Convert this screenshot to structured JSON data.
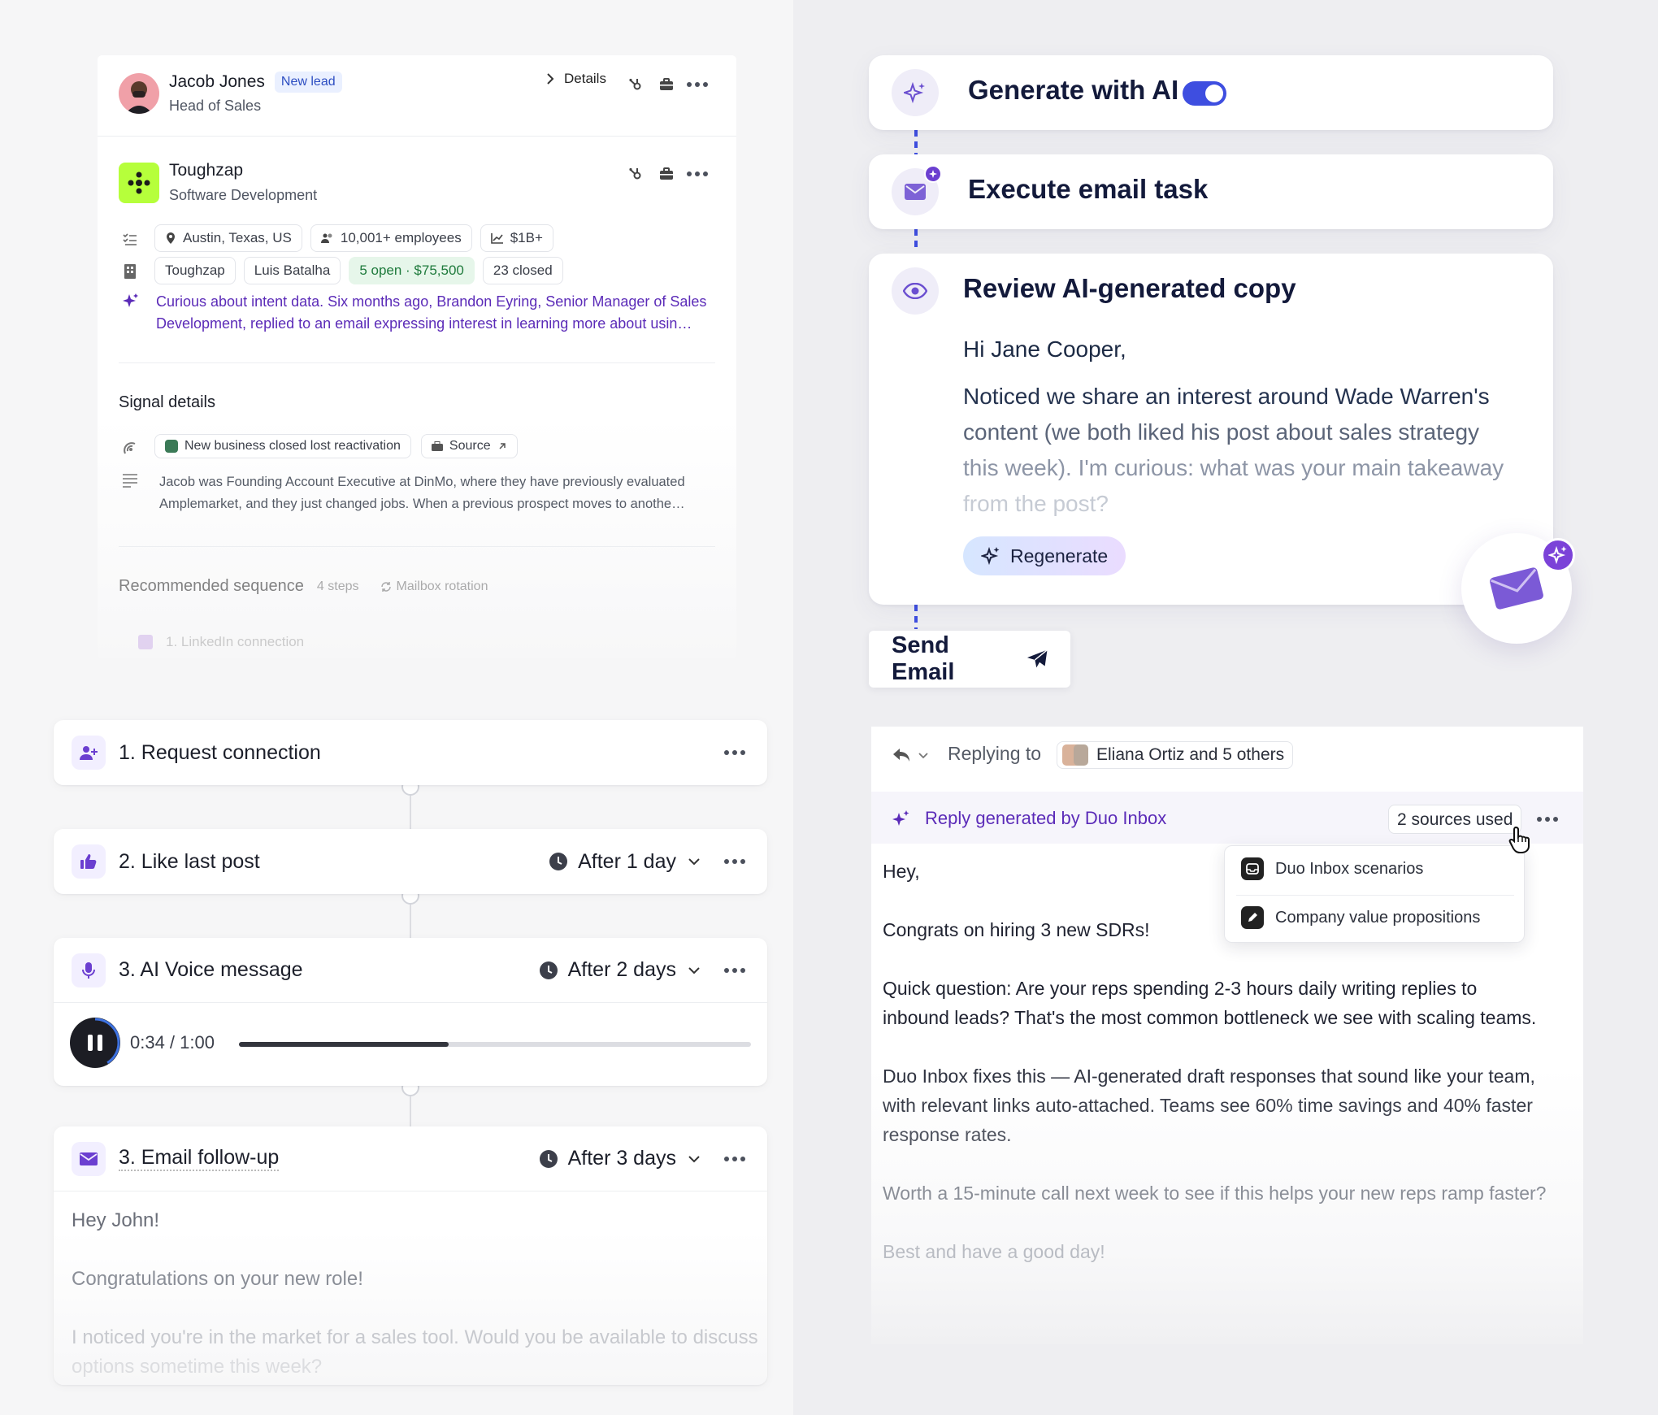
{
  "lead": {
    "name": "Jacob Jones",
    "badge": "New lead",
    "title": "Head of Sales",
    "details_label": "Details"
  },
  "company": {
    "name": "Toughzap",
    "industry": "Software Development",
    "location": "Austin, Texas, US",
    "employees": "10,001+ employees",
    "revenue": "$1B+",
    "account_name": "Toughzap",
    "owner": "Luis Batalha",
    "open_deals": "5 open · $75,500",
    "closed_deals": "23 closed",
    "insight": "Curious about intent data. Six months ago, Brandon Eyring, Senior Manager of Sales Development, replied to an email expressing interest in learning more about usin…"
  },
  "signal": {
    "heading": "Signal details",
    "tag": "New business closed lost reactivation",
    "source_label": "Source",
    "description": "Jacob was Founding Account Executive at DinMo, where they have previously evaluated Amplemarket, and they just changed jobs. When a previous prospect moves to anothe…"
  },
  "recommended": {
    "heading": "Recommended sequence",
    "steps": "4 steps",
    "rotation": "Mailbox rotation",
    "first_step": "1. LinkedIn connection"
  },
  "sequence": {
    "steps": [
      {
        "label": "1. Request connection"
      },
      {
        "label": "2. Like last post",
        "delay": "After 1 day"
      },
      {
        "label": "3. AI Voice message",
        "delay": "After 2 days"
      },
      {
        "label": "3. Email follow-up",
        "delay": "After 3 days"
      }
    ],
    "voice": {
      "time": "0:34 / 1:00",
      "progress": 0.41
    },
    "email": {
      "greeting": "Hey John!",
      "line1": "Congratulations on your new role!",
      "line2": "I noticed you're in the market for a sales tool. Would you be available to discuss",
      "line3": "options sometime this week?"
    }
  },
  "flow": {
    "generate_label": "Generate with AI",
    "toggle_on": true,
    "execute_label": "Execute email task",
    "review_label": "Review AI-generated copy",
    "greeting": "Hi Jane Cooper,",
    "body_line1": "Noticed we share an interest around Wade Warren's",
    "body_line2": "content (we both liked his post about sales strategy",
    "body_line3": "this week). I'm curious: what was your main takeaway",
    "body_line4": "from the post?",
    "regenerate_label": "Regenerate",
    "send_label": "Send Email"
  },
  "reply": {
    "replying_to_label": "Replying to",
    "recipients": "Eliana Ortiz and 5 others",
    "generated_by": "Reply generated by Duo Inbox",
    "sources_label": "2 sources used",
    "sources": [
      "Duo Inbox scenarios",
      "Company value propositions"
    ],
    "p1": "Hey,",
    "p2": "Congrats on hiring 3 new SDRs!",
    "p3a": "Quick question: Are your reps spending 2-3 hours daily writing replies to",
    "p3b": "inbound leads? That's the most common bottleneck we see with scaling teams.",
    "p4a": "Duo Inbox fixes this — AI-generated draft responses that sound like your team,",
    "p4b": "with relevant links auto-attached. Teams see 60% time savings and 40% faster",
    "p4c": "response rates.",
    "p5": "Worth a 15-minute call next week to see if this helps your new reps ramp faster?",
    "p6": "Best and have a good day!"
  },
  "colors": {
    "accent": "#3e4ee0",
    "ai_purple": "#5b2bb8",
    "brand_green": "#b6ff3b",
    "open_deals_bg": "#e6f6ea"
  }
}
